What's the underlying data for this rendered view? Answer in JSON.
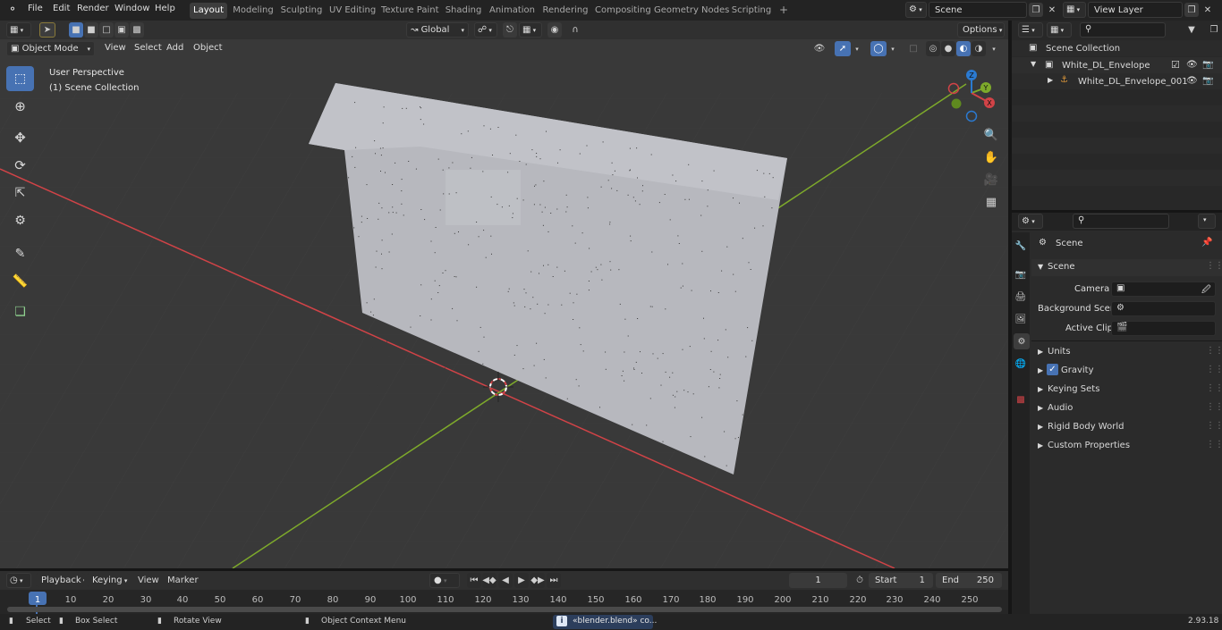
{
  "topbar": {
    "menus": [
      "File",
      "Edit",
      "Render",
      "Window",
      "Help"
    ],
    "workspace_tabs": [
      "Layout",
      "Modeling",
      "Sculpting",
      "UV Editing",
      "Texture Paint",
      "Shading",
      "Animation",
      "Rendering",
      "Compositing",
      "Geometry Nodes",
      "Scripting"
    ],
    "active_tab": "Layout",
    "add_tab": "+",
    "scene_name": "Scene",
    "view_layer_name": "View Layer"
  },
  "tool_header": {
    "orientation": "Global",
    "options": "Options"
  },
  "viewport_header": {
    "mode": "Object Mode",
    "menus": [
      "View",
      "Select",
      "Add",
      "Object"
    ]
  },
  "viewport": {
    "perspective_label": "User Perspective",
    "collection_label": "(1) Scene Collection",
    "gizmo_axes": [
      "X",
      "Y",
      "Z"
    ],
    "colors": {
      "x_axis": "#d14347",
      "y_axis": "#7eaa2b",
      "z_axis": "#2b7ad1",
      "active_tool": "#4772b3",
      "plane": "#b7b8be"
    }
  },
  "toolbar_tools": [
    "select-box-icon",
    "cursor-icon",
    "move-icon",
    "rotate-icon",
    "scale-icon",
    "transform-icon",
    "annotate-icon",
    "measure-icon",
    "add-cube-icon"
  ],
  "outliner": {
    "root": "Scene Collection",
    "items": [
      {
        "label": "White_DL_Envelope",
        "level": 1
      },
      {
        "label": "White_DL_Envelope_001",
        "level": 2
      }
    ]
  },
  "properties": {
    "context_label": "Scene",
    "section_title": "Scene",
    "fields": [
      {
        "label": "Camera",
        "value": ""
      },
      {
        "label": "Background Scene",
        "value": ""
      },
      {
        "label": "Active Clip",
        "value": ""
      }
    ],
    "panels": [
      {
        "label": "Units",
        "checkbox": false
      },
      {
        "label": "Gravity",
        "checkbox": true
      },
      {
        "label": "Keying Sets",
        "checkbox": false
      },
      {
        "label": "Audio",
        "checkbox": false
      },
      {
        "label": "Rigid Body World",
        "checkbox": false
      },
      {
        "label": "Custom Properties",
        "checkbox": false
      }
    ]
  },
  "timeline": {
    "menus": [
      "Playback",
      "Keying",
      "View",
      "Marker"
    ],
    "current_frame": "1",
    "start_label": "Start",
    "start_value": "1",
    "end_label": "End",
    "end_value": "250",
    "ticks": [
      "1",
      "10",
      "20",
      "30",
      "40",
      "50",
      "60",
      "70",
      "80",
      "90",
      "100",
      "110",
      "120",
      "130",
      "140",
      "150",
      "160",
      "170",
      "180",
      "190",
      "200",
      "210",
      "220",
      "230",
      "240",
      "250"
    ]
  },
  "statusbar": {
    "hints": [
      "Select",
      "Box Select",
      "Rotate View",
      "Object Context Menu"
    ],
    "message": "«blender.blend» co...",
    "version": "2.93.18"
  }
}
